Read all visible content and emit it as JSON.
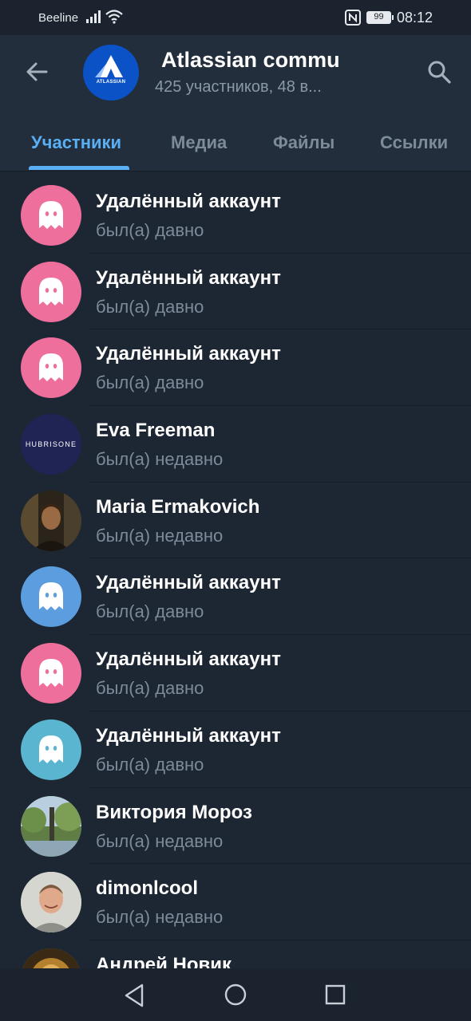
{
  "status_bar": {
    "carrier": "Beeline",
    "battery": "99",
    "time": "08:12"
  },
  "header": {
    "title": "Atlassian commu",
    "subtitle": "425 участников, 48 в...",
    "avatar_text": "ATLASSIAN",
    "avatar_color": "#0b52c6"
  },
  "tabs": [
    {
      "label": "Участники",
      "active": true
    },
    {
      "label": "Медиа",
      "active": false
    },
    {
      "label": "Файлы",
      "active": false
    },
    {
      "label": "Ссылки",
      "active": false
    }
  ],
  "members": [
    {
      "name": "Удалённый аккаунт",
      "status": "был(а) давно",
      "avatar": "ghost",
      "color": "#ef6f9c"
    },
    {
      "name": "Удалённый аккаунт",
      "status": "был(а) давно",
      "avatar": "ghost",
      "color": "#ef6f9c"
    },
    {
      "name": "Удалённый аккаунт",
      "status": "был(а) давно",
      "avatar": "ghost",
      "color": "#ef6f9c"
    },
    {
      "name": "Eva Freeman",
      "status": "был(а) недавно",
      "avatar": "text-logo",
      "color": "#1f2454",
      "logo_text": "HUBRISONE"
    },
    {
      "name": "Maria Ermakovich",
      "status": "был(а) недавно",
      "avatar": "photo-portrait-dark",
      "color": "#3a2f1f"
    },
    {
      "name": "Удалённый аккаунт",
      "status": "был(а) давно",
      "avatar": "ghost",
      "color": "#5c9de0"
    },
    {
      "name": "Удалённый аккаунт",
      "status": "был(а) давно",
      "avatar": "ghost",
      "color": "#ef6f9c"
    },
    {
      "name": "Удалённый аккаунт",
      "status": "был(а) давно",
      "avatar": "ghost",
      "color": "#59b5d0"
    },
    {
      "name": "Виктория Мороз",
      "status": "был(а) недавно",
      "avatar": "photo-nature",
      "color": "#6b8a4e"
    },
    {
      "name": "dimonlcool",
      "status": "был(а) недавно",
      "avatar": "photo-man",
      "color": "#c9c9c2"
    },
    {
      "name": "Андрей Новик",
      "status": "",
      "avatar": "photo-warm",
      "color": "#b5802e"
    }
  ],
  "icons": {
    "back": "arrow-left-icon",
    "search": "search-icon",
    "nav_back": "triangle-back-icon",
    "nav_home": "circle-home-icon",
    "nav_recent": "square-recent-icon"
  },
  "colors": {
    "accent": "#5aaef3",
    "background": "#1d2733",
    "header": "#222e3b",
    "secondary_text": "#7d8b99"
  }
}
